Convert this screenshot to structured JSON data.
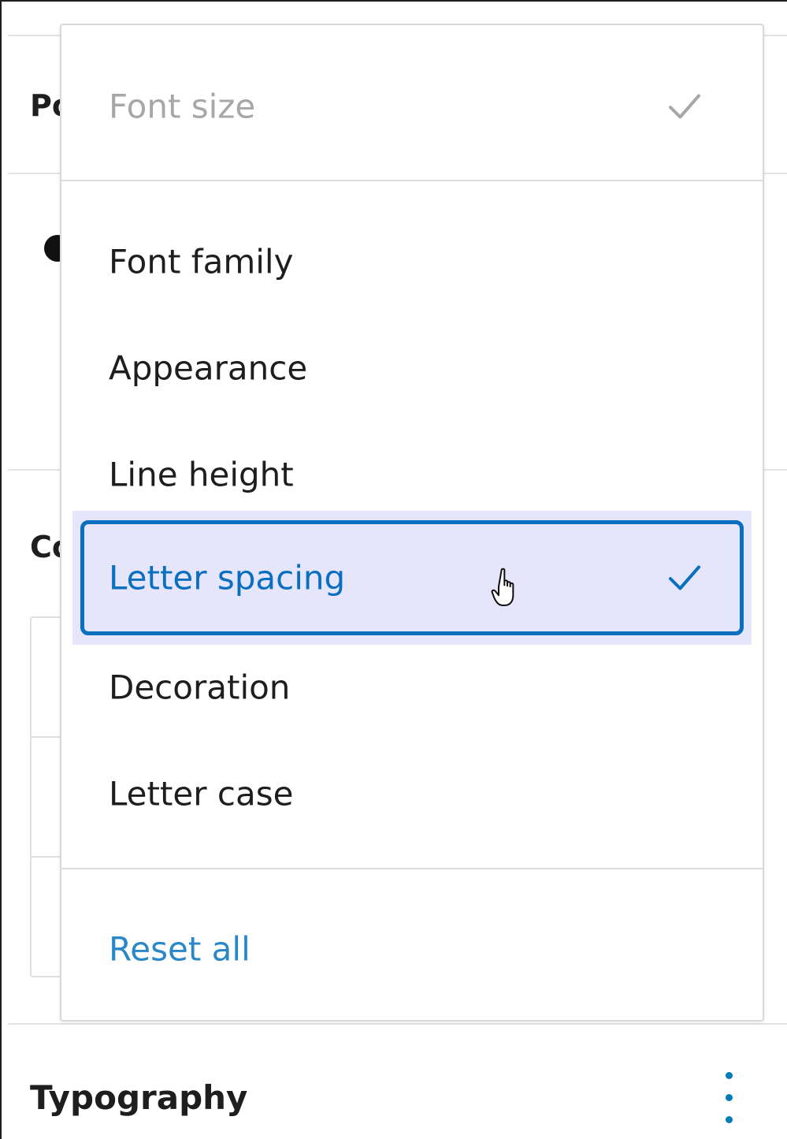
{
  "background": {
    "section_partial_1": "Po",
    "section_partial_2": "Co",
    "typography_title": "Typography",
    "options_icon": "more-vertical-icon"
  },
  "menu": {
    "header_item": {
      "label": "Font size",
      "state": "disabled-checked",
      "icon": "check-icon"
    },
    "items": [
      {
        "label": "Font family",
        "checked": false
      },
      {
        "label": "Appearance",
        "checked": false
      },
      {
        "label": "Line height",
        "checked": false
      },
      {
        "label": "Letter spacing",
        "checked": true,
        "highlighted": true,
        "icon": "check-icon"
      },
      {
        "label": "Decoration",
        "checked": false
      },
      {
        "label": "Letter case",
        "checked": false
      }
    ],
    "reset_label": "Reset all"
  },
  "colors": {
    "accent": "#0a6fbf",
    "highlight_bg": "#e5e5fb",
    "link": "#2a88c9",
    "disabled_text": "#a7a7a7"
  },
  "cursor": "pointer-hand-icon"
}
